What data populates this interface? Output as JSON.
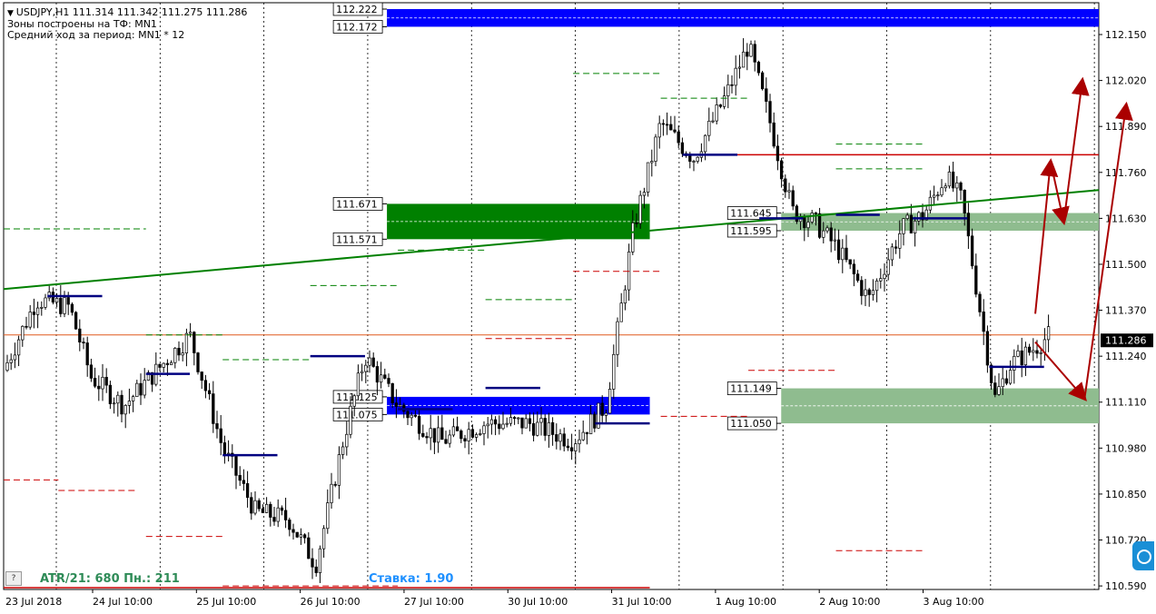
{
  "window": {
    "header": "USDJPY,H1  111.314 111.342 111.275 111.286",
    "info_lines": [
      "Зоны построены на ТФ: MN1",
      "Средний ход за период: MN1 * 12"
    ]
  },
  "footer": {
    "atr": "ATR/21: 680  Пн.: 211",
    "stake": "Ставка: 1.90",
    "help_label": "?"
  },
  "colors": {
    "candle": "#000000",
    "blue_zone": "#0000ff",
    "green_zone": "#008000",
    "light_green_zone": "#8fbc8f",
    "trend_line": "#008000",
    "resistance_line": "#cc0000",
    "price_line": "#e05a1e",
    "arrows": "#aa0000",
    "current_price_bg": "#000000"
  },
  "chart_data": {
    "type": "candlestick",
    "symbol": "USDJPY",
    "timeframe": "H1",
    "ohlc": {
      "open": 111.314,
      "high": 111.342,
      "low": 111.275,
      "close": 111.286
    },
    "current_price": "111.286",
    "ylim": [
      110.58,
      112.24
    ],
    "y_ticks": [
      "112.150",
      "112.020",
      "111.890",
      "111.760",
      "111.630",
      "111.500",
      "111.370",
      "111.240",
      "111.110",
      "110.980",
      "110.850",
      "110.720",
      "110.590"
    ],
    "x_labels": [
      "23 Jul 2018",
      "24 Jul 10:00",
      "25 Jul 10:00",
      "26 Jul 10:00",
      "27 Jul 10:00",
      "30 Jul 10:00",
      "31 Jul 10:00",
      "1 Aug 10:00",
      "2 Aug 10:00",
      "3 Aug 10:00"
    ],
    "grid": "vertical-dotted",
    "zones": [
      {
        "kind": "blue",
        "from": 112.172,
        "to": 112.222,
        "start": 0.35,
        "end": 1.0,
        "labels": [
          "112.222",
          "112.172"
        ]
      },
      {
        "kind": "green",
        "from": 111.571,
        "to": 111.671,
        "start": 0.35,
        "end": 0.59,
        "labels": [
          "111.671",
          "111.571"
        ]
      },
      {
        "kind": "blue",
        "from": 111.075,
        "to": 111.125,
        "start": 0.35,
        "end": 0.59,
        "labels": [
          "111.125",
          "111.075"
        ]
      },
      {
        "kind": "light-green",
        "from": 111.595,
        "to": 111.645,
        "start": 0.71,
        "end": 1.0,
        "labels": [
          "111.645",
          "111.595"
        ]
      },
      {
        "kind": "light-green",
        "from": 111.05,
        "to": 111.149,
        "start": 0.71,
        "end": 1.0,
        "labels": [
          "111.149",
          "111.050"
        ]
      }
    ],
    "trend_line": {
      "from": [
        0,
        111.43
      ],
      "to": [
        1.0,
        111.71
      ]
    },
    "horizontal_lines": [
      {
        "kind": "resistance",
        "price": 111.81,
        "start": 0.67,
        "end": 1.0
      },
      {
        "kind": "price",
        "price": 111.3,
        "start": 0,
        "end": 1.0
      },
      {
        "kind": "low",
        "price": 110.585,
        "start": 0,
        "end": 0.59
      }
    ],
    "forecast_arrows": [
      [
        [
          0.942,
          111.36
        ],
        [
          0.956,
          111.79
        ]
      ],
      [
        [
          0.956,
          111.79
        ],
        [
          0.968,
          111.62
        ]
      ],
      [
        [
          0.968,
          111.62
        ],
        [
          0.985,
          112.02
        ]
      ],
      [
        [
          0.942,
          111.28
        ],
        [
          0.987,
          111.12
        ]
      ],
      [
        [
          0.987,
          111.12
        ],
        [
          1.025,
          111.95
        ]
      ]
    ]
  }
}
